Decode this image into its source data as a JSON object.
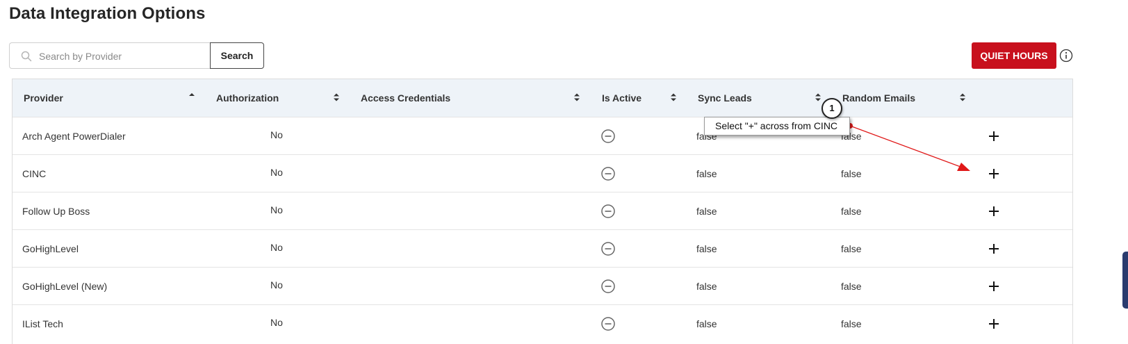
{
  "page": {
    "title": "Data Integration Options"
  },
  "search": {
    "placeholder": "Search by Provider",
    "value": "",
    "button_label": "Search"
  },
  "actions": {
    "quiet_hours_label": "QUIET HOURS"
  },
  "table": {
    "columns": [
      {
        "label": "Provider",
        "sort": "asc"
      },
      {
        "label": "Authorization",
        "sort": "both"
      },
      {
        "label": "Access Credentials",
        "sort": "both"
      },
      {
        "label": "Is Active",
        "sort": "both"
      },
      {
        "label": "Sync Leads",
        "sort": "both"
      },
      {
        "label": "Random Emails",
        "sort": "both"
      }
    ],
    "rows": [
      {
        "provider": "Arch Agent PowerDialer",
        "authorization": "No",
        "access_credentials": "",
        "is_active": "inactive",
        "sync_leads": "false",
        "random_emails": "false"
      },
      {
        "provider": "CINC",
        "authorization": "No",
        "access_credentials": "",
        "is_active": "inactive",
        "sync_leads": "false",
        "random_emails": "false"
      },
      {
        "provider": "Follow Up Boss",
        "authorization": "No",
        "access_credentials": "",
        "is_active": "inactive",
        "sync_leads": "false",
        "random_emails": "false"
      },
      {
        "provider": "GoHighLevel",
        "authorization": "No",
        "access_credentials": "",
        "is_active": "inactive",
        "sync_leads": "false",
        "random_emails": "false"
      },
      {
        "provider": "GoHighLevel (New)",
        "authorization": "No",
        "access_credentials": "",
        "is_active": "inactive",
        "sync_leads": "false",
        "random_emails": "false"
      },
      {
        "provider": "IList Tech",
        "authorization": "No",
        "access_credentials": "",
        "is_active": "inactive",
        "sync_leads": "false",
        "random_emails": "false"
      }
    ]
  },
  "annotation": {
    "step": "1",
    "text": "Select \"+\" across from CINC"
  },
  "icons": {
    "search": "search-icon",
    "info": "info-icon",
    "sort": "sort-icon",
    "inactive": "minus-circle-icon",
    "add": "plus-icon"
  },
  "colors": {
    "primary_red": "#c8101d",
    "header_bg": "#eef3f8",
    "annotation_arrow": "#e01818"
  }
}
